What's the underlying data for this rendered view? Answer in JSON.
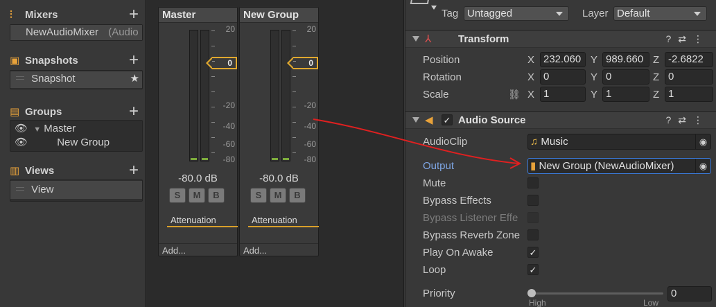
{
  "mixer_window": {
    "sections": {
      "mixers": {
        "title": "Mixers",
        "items": [
          {
            "label": "NewAudioMixer",
            "suffix": "(Audio"
          }
        ]
      },
      "snapshots": {
        "title": "Snapshots",
        "items": [
          {
            "label": "Snapshot"
          }
        ]
      },
      "groups": {
        "title": "Groups",
        "items": [
          {
            "label": "Master"
          },
          {
            "label": "New Group"
          }
        ]
      },
      "views": {
        "title": "Views",
        "items": [
          {
            "label": "View"
          }
        ]
      }
    },
    "strips": [
      {
        "title": "Master",
        "level_db": "-80.0 dB",
        "attenuation_label": "Attenuation",
        "add_label": "Add...",
        "fader_value": "0"
      },
      {
        "title": "New Group",
        "level_db": "-80.0 dB",
        "attenuation_label": "Attenuation",
        "add_label": "Add...",
        "fader_value": "0"
      }
    ],
    "meter_scale": [
      "20",
      "0",
      "-20",
      "-40",
      "-60",
      "-80"
    ],
    "smb": [
      "S",
      "M",
      "B"
    ]
  },
  "inspector": {
    "tag_label": "Tag",
    "tag_value": "Untagged",
    "layer_label": "Layer",
    "layer_value": "Default",
    "transform": {
      "title": "Transform",
      "position_label": "Position",
      "rotation_label": "Rotation",
      "scale_label": "Scale",
      "position": {
        "x": "232.060",
        "y": "989.660",
        "z": "-2.6822"
      },
      "rotation": {
        "x": "0",
        "y": "0",
        "z": "0"
      },
      "scale": {
        "x": "1",
        "y": "1",
        "z": "1"
      },
      "axis_x": "X",
      "axis_y": "Y",
      "axis_z": "Z"
    },
    "audio_source": {
      "title": "Audio Source",
      "audioclip_label": "AudioClip",
      "audioclip_value": "Music",
      "output_label": "Output",
      "output_value": "New Group (NewAudioMixer)",
      "mute_label": "Mute",
      "bypass_effects_label": "Bypass Effects",
      "bypass_listener_label": "Bypass Listener Effe",
      "bypass_reverb_label": "Bypass Reverb Zone",
      "play_on_awake_label": "Play On Awake",
      "loop_label": "Loop",
      "priority_label": "Priority",
      "priority_value": "0",
      "priority_min_label": "High",
      "priority_max_label": "Low",
      "play_on_awake": true,
      "loop": true,
      "mute": false
    }
  },
  "colors": {
    "accent": "#e0a82e",
    "annotation_arrow": "#e02020",
    "output_label": "#8ab4f8"
  }
}
